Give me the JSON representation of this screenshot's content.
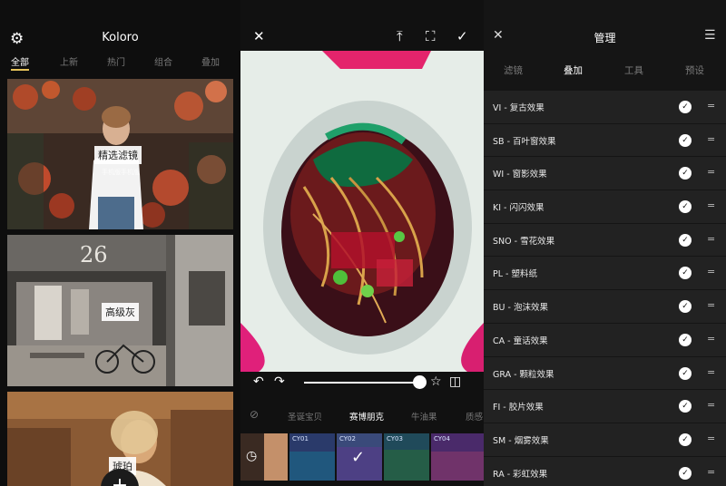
{
  "left": {
    "app_title": "Koloro",
    "tabs": [
      "全部",
      "上新",
      "热门",
      "组合",
      "叠加"
    ],
    "cards": [
      {
        "label": "精选滤镜",
        "sub": "手机版手机版"
      },
      {
        "label": "高级灰",
        "sub": ""
      },
      {
        "label": "琥珀",
        "sub": ""
      }
    ],
    "fab_label": "+"
  },
  "center": {
    "slider_value": 0.94,
    "filter_names": [
      "圣诞宝贝",
      "赛博朋克",
      "牛油果",
      "质感"
    ],
    "thumbs": [
      "CY01",
      "CY02",
      "CY03",
      "CY04"
    ]
  },
  "right": {
    "title": "管理",
    "tabs": [
      "滤镜",
      "叠加",
      "工具",
      "预设"
    ],
    "active_tab": "叠加",
    "effects": [
      "VI - 复古效果",
      "SB - 百叶窗效果",
      "WI - 窗影效果",
      "KI - 闪闪效果",
      "SNO - 雪花效果",
      "PL - 塑料纸",
      "BU - 泡沫效果",
      "CA - 童话效果",
      "GRA - 颗粒效果",
      "FI - 胶片效果",
      "SM - 烟雾效果",
      "RA - 彩虹效果"
    ]
  },
  "colors": {
    "accent": "#e6c35a",
    "panel": "#222222",
    "background": "#000000"
  },
  "icons": [
    "gear-icon",
    "close-icon",
    "upload-icon",
    "crop-icon",
    "confirm-icon",
    "undo-icon",
    "redo-icon",
    "star-icon",
    "compare-icon",
    "none-icon",
    "history-icon",
    "menu-icon",
    "check-icon",
    "drag-handle-icon"
  ]
}
